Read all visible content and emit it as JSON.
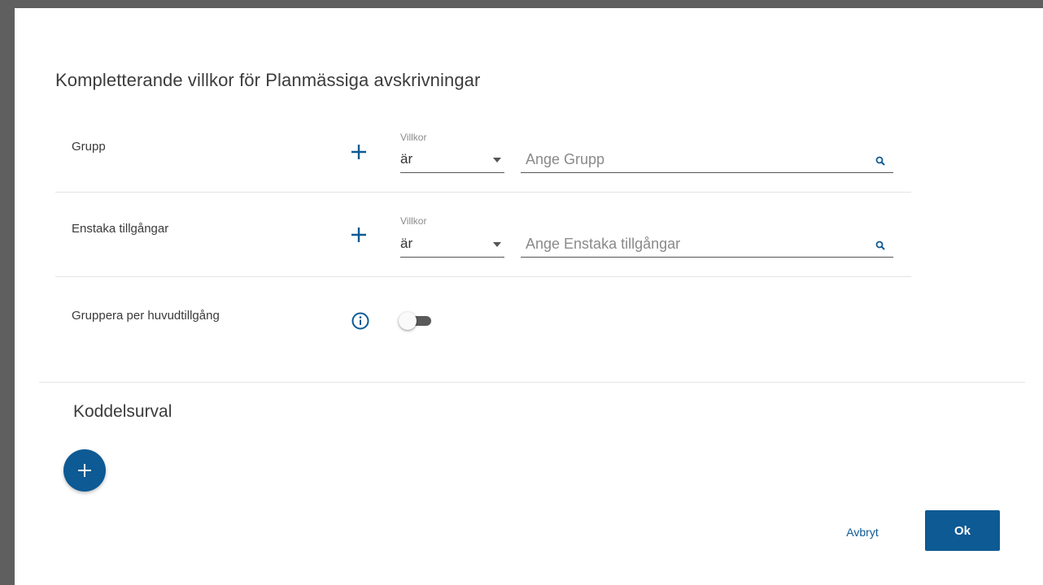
{
  "dialog": {
    "title": "Kompletterande villkor för Planmässiga avskrivningar"
  },
  "rows": [
    {
      "label": "Grupp",
      "villkor_label": "Villkor",
      "villkor_value": "är",
      "placeholder": "Ange Grupp"
    },
    {
      "label": "Enstaka tillgångar",
      "villkor_label": "Villkor",
      "villkor_value": "är",
      "placeholder": "Ange Enstaka tillgångar"
    }
  ],
  "group_by": {
    "label": "Gruppera per huvudtillgång",
    "toggle_on": false
  },
  "section": {
    "title": "Koddelsurval"
  },
  "footer": {
    "cancel_label": "Avbryt",
    "ok_label": "Ok"
  },
  "colors": {
    "accent": "#0d5a94",
    "backdrop": "#5f5f5f"
  }
}
